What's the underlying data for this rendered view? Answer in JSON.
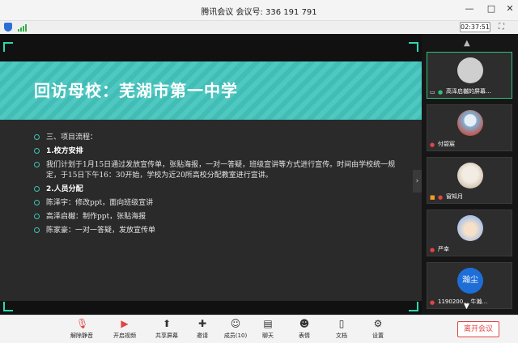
{
  "window": {
    "title": "腾讯会议 会议号: 336 191 791",
    "controls": {
      "minimize": "—",
      "maximize": "□",
      "close": "✕"
    }
  },
  "subbar": {
    "timer": "02:37:51"
  },
  "slide": {
    "title": "回访母校：芜湖市第一中学",
    "items": [
      {
        "text": "三、项目流程：",
        "bold": false
      },
      {
        "text": "1.校方安排",
        "bold": true
      },
      {
        "text": "我们计划于1月15日通过发放宣传单，张贴海报，一对一答疑，班级宣讲等方式进行宣传。时间由学校统一规定，于15日下午16：30开始，学校为近20所高校分配教室进行宣讲。",
        "bold": false
      },
      {
        "text": "2.人员分配",
        "bold": true
      },
      {
        "text": "陈泽宇：修改ppt，面向班级宣讲",
        "bold": false
      },
      {
        "text": "高泽启樾：制作ppt，张贴海报",
        "bold": false
      },
      {
        "text": "陈家豪：一对一答疑，发放宣传单",
        "bold": false
      }
    ]
  },
  "participants": [
    {
      "label": "高泽启樾的屏幕…",
      "avatar_text": "",
      "color": "#cfcfcf"
    },
    {
      "label": "付碧宸",
      "avatar_text": "",
      "color": "#7fb3d8"
    },
    {
      "label": "窗知月",
      "avatar_text": "",
      "color": "#e8ddd0"
    },
    {
      "label": "严幸",
      "avatar_text": "",
      "color": "#a9c0e6"
    },
    {
      "label": "1190200… 牛瀚…",
      "avatar_text": "瀚尘",
      "color": "#1e6ed8"
    }
  ],
  "toolbar": {
    "unmute": "解除静音",
    "video": "开启视频",
    "share": "共享屏幕",
    "invite": "邀请",
    "members": "成员(10)",
    "chat": "聊天",
    "reaction": "表情",
    "docs": "文档",
    "settings": "设置",
    "leave": "离开会议"
  }
}
